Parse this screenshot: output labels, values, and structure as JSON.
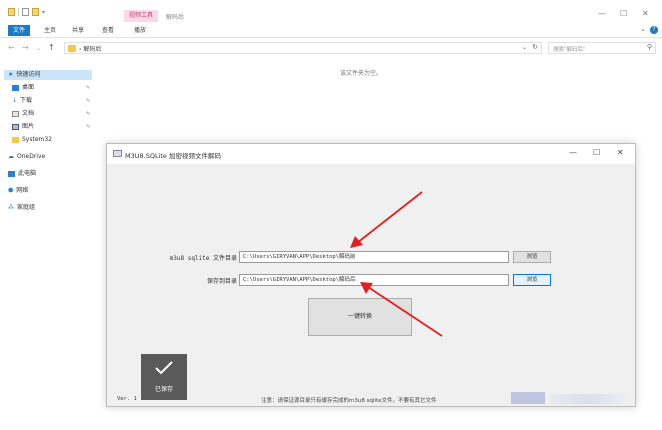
{
  "explorer": {
    "context_tab": "视频工具",
    "title": "解码后",
    "ribbon_tabs": [
      "文件",
      "主页",
      "共享",
      "查看",
      "播放"
    ],
    "address_crumb": "解码后",
    "search_placeholder": "搜索\"解码后\"",
    "empty_message": "该文件夹为空。",
    "nav": {
      "quick_access": "快速访问",
      "items": [
        "桌面",
        "下载",
        "文档",
        "图片",
        "System32"
      ],
      "onedrive": "OneDrive",
      "this_pc": "此电脑",
      "network": "网络",
      "homegroup": "家庭组"
    }
  },
  "dialog": {
    "title": "M3U8.SQLite 加密视频文件解码",
    "source_label": "m3u8 sqlite 文件目录",
    "source_value": "C:\\Users\\GIRYVAN\\APP\\Desktop\\解码前",
    "target_label": "保存到目录",
    "target_value": "C:\\Users\\GIRYVAN\\APP\\Desktop\\解码后",
    "browse_label": "浏览",
    "convert_label": "一键转换",
    "saved_label": "已保存",
    "version": "Ver. 1",
    "note": "注意：请保证源目录只有缓存完成的m3u8 sqlite文件，不要有其它文件"
  },
  "colors": {
    "accent": "#1979ca",
    "arrow": "#e02020",
    "saved_badge": "#5a5a5a",
    "dialog_bg": "#f0f0f0"
  }
}
